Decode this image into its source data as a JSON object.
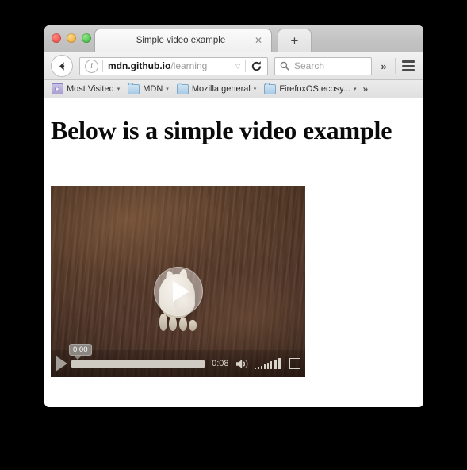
{
  "window": {
    "traffic_lights": [
      "close",
      "minimize",
      "zoom"
    ]
  },
  "tabs": [
    {
      "title": "Simple video example",
      "close_label": "✕",
      "active": true
    }
  ],
  "newtab": {
    "label": "+"
  },
  "navbar": {
    "back_label": "←",
    "identity_label": "i",
    "url_host": "mdn.github.io",
    "url_path": "/learning",
    "url_dropdown": "▽",
    "reload_label": "↻",
    "search_placeholder": "Search",
    "overflow_label": "»",
    "menu_label": "menu"
  },
  "bookmarks": {
    "items": [
      {
        "label": "Most Visited",
        "icon": "most-visited-icon",
        "caret": "▾"
      },
      {
        "label": "MDN",
        "icon": "folder-icon",
        "caret": "▾"
      },
      {
        "label": "Mozilla general",
        "icon": "folder-icon",
        "caret": "▾"
      },
      {
        "label": "FirefoxOS ecosy...",
        "icon": "folder-icon",
        "caret": "▾"
      }
    ],
    "overflow": "»"
  },
  "page": {
    "heading": "Below is a simple video example"
  },
  "video": {
    "poster_description": "white rabbit on a wooden floor",
    "big_play_label": "play",
    "controls": {
      "play_label": "play",
      "current_time": "0:00",
      "duration": "0:08",
      "progress_percent": 0,
      "volume_level": 6,
      "volume_icon": "speaker-icon",
      "fullscreen_icon": "fullscreen-icon"
    }
  },
  "colors": {
    "page_background": "#000000",
    "window_background": "#ffffff",
    "chrome_tabstrip": "#c3c3c3",
    "chrome_toolbar": "#e9e9e9",
    "heading_text": "#0a0a0a",
    "url_host_text": "#1a1a1a",
    "url_path_text": "#9a9a9a",
    "video_wood": "#5e3f2b",
    "control_track": "#cfcbc2",
    "tooltip_background": "#8b8780",
    "light_red": "#f25650",
    "light_yellow": "#f3b343",
    "light_green": "#4bc24b"
  }
}
